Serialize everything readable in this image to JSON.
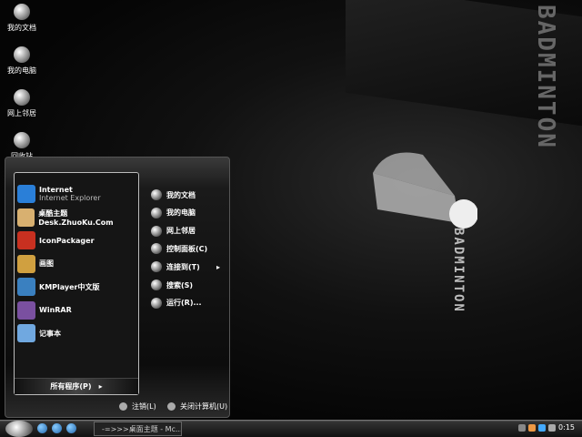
{
  "desktop": {
    "icons": [
      {
        "label": "我的文档"
      },
      {
        "label": "我的电脑"
      },
      {
        "label": "网上邻居"
      },
      {
        "label": "回收站"
      }
    ],
    "wallpaper_text": "BADMINTON"
  },
  "start_menu": {
    "programs": [
      {
        "label": "Internet",
        "sub": "Internet Explorer",
        "icon": "ie-icon",
        "color": "#2a7fd8"
      },
      {
        "label": "桌酷主题Desk.ZhuoKu.Com",
        "icon": "theme-icon",
        "color": "#d8b070"
      },
      {
        "label": "IconPackager",
        "icon": "iconpackager-icon",
        "color": "#c83020"
      },
      {
        "label": "画图",
        "icon": "paint-icon",
        "color": "#d0a040"
      },
      {
        "label": "KMPlayer中文版",
        "icon": "kmplayer-icon",
        "color": "#3a80c0"
      },
      {
        "label": "WinRAR",
        "icon": "winrar-icon",
        "color": "#7a50a0"
      },
      {
        "label": "记事本",
        "icon": "notepad-icon",
        "color": "#70a8e0"
      }
    ],
    "all_programs": "所有程序(P)",
    "places": [
      {
        "label": "我的文档"
      },
      {
        "label": "我的电脑"
      },
      {
        "label": "网上邻居"
      },
      {
        "label": "控制面板(C)"
      },
      {
        "label": "连接到(T)"
      },
      {
        "label": "搜索(S)"
      },
      {
        "label": "运行(R)..."
      }
    ],
    "logoff": "注销(L)",
    "shutdown": "关闭计算机(U)"
  },
  "taskbar": {
    "task": "-=>>>桌面主题 - Mc...",
    "clock": "0:15"
  }
}
